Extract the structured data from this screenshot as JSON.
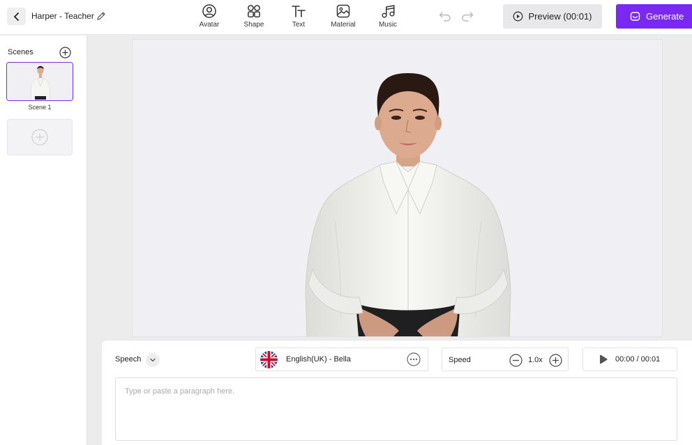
{
  "header": {
    "project_title": "Harper - Teacher",
    "tools": [
      {
        "label": "Avatar",
        "icon": "avatar-icon"
      },
      {
        "label": "Shape",
        "icon": "shape-icon"
      },
      {
        "label": "Text",
        "icon": "text-icon"
      },
      {
        "label": "Material",
        "icon": "material-icon"
      },
      {
        "label": "Music",
        "icon": "music-icon"
      }
    ],
    "preview_label": "Preview (00:01)",
    "generate_label": "Generate"
  },
  "sidebar": {
    "title": "Scenes",
    "scenes": [
      {
        "name": "Scene 1"
      }
    ]
  },
  "speech": {
    "label": "Speech",
    "voice": "English(UK) - Bella",
    "speed_label": "Speed",
    "speed_value": "1.0x",
    "time": "00:00 / 00:01",
    "placeholder": "Type or paste a paragraph here."
  },
  "colors": {
    "accent": "#7a2af0",
    "canvas_bg": "#f0f0f4"
  }
}
